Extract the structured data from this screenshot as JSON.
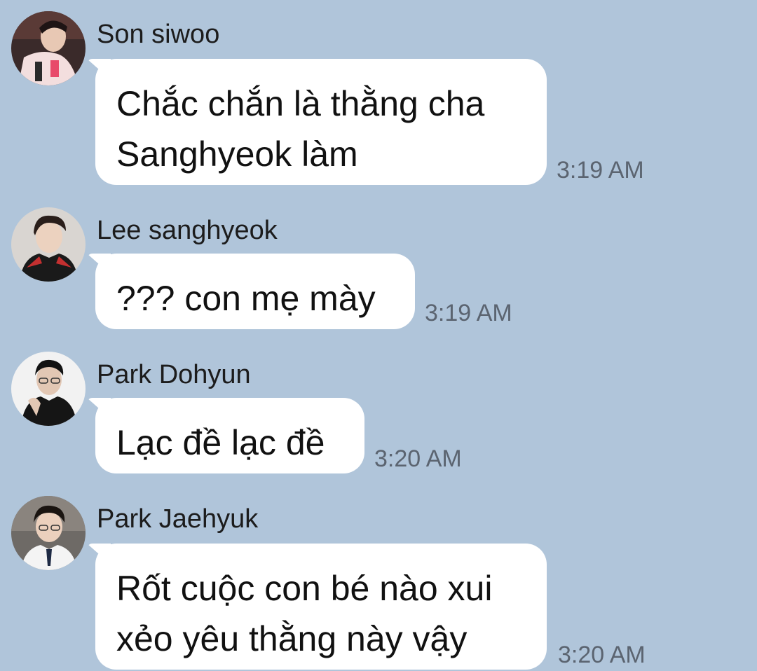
{
  "messages": [
    {
      "sender": "Son siwoo",
      "avatar_icon": "profile-photo-icon",
      "lines": [
        "Chắc chắn là thằng cha",
        "Sanghyeok làm"
      ],
      "time": "3:19 AM"
    },
    {
      "sender": "Lee sanghyeok",
      "avatar_icon": "profile-photo-icon",
      "lines": [
        "??? con mẹ mày"
      ],
      "time": "3:19 AM"
    },
    {
      "sender": "Park Dohyun",
      "avatar_icon": "profile-photo-icon",
      "lines": [
        "Lạc đề lạc đề"
      ],
      "time": "3:20 AM"
    },
    {
      "sender": "Park Jaehyuk",
      "avatar_icon": "profile-photo-icon",
      "lines": [
        "Rốt cuộc con bé nào xui",
        "xẻo yêu thằng này vậy"
      ],
      "time": "3:20 AM"
    }
  ],
  "colors": {
    "background": "#b0c5da",
    "bubble": "#ffffff",
    "sender_text": "#1c1c1c",
    "time_text": "#5b6470"
  }
}
